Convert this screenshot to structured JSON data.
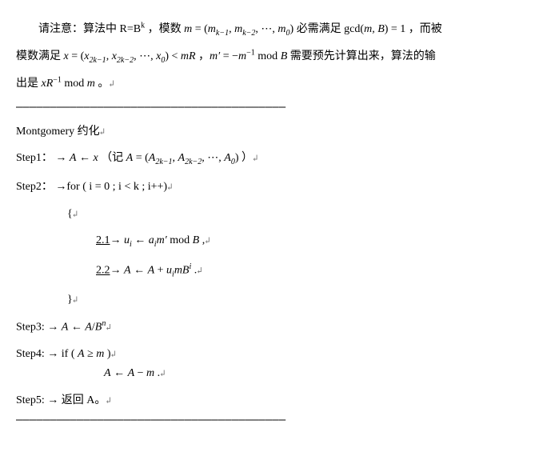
{
  "intro": {
    "line1_pre": "　　请注意：算法中 R=B",
    "line1_sup": "k",
    "line1_mid": " ，模数 ",
    "line1_m": "m",
    "line1_eq": " = (",
    "line1_mk1": "m",
    "line1_mk1_sub": "k−1",
    "line1_c1": ", ",
    "line1_mk2": "m",
    "line1_mk2_sub": "k−2",
    "line1_c2": ", ⋯, ",
    "line1_m0": "m",
    "line1_m0_sub": "0",
    "line1_close": ") ",
    "line1_must": "必需满足 gcd(",
    "line1_mB": "m, B",
    "line1_eq1": ") = 1 ，而被",
    "line2_pre": "模数满足 ",
    "line2_x": "x",
    "line2_eq": " = (",
    "line2_x1": "x",
    "line2_x1_sub": "2k−1",
    "line2_c1": ", ",
    "line2_x2": "x",
    "line2_x2_sub": "2k−2",
    "line2_c2": ", ⋯, ",
    "line2_x0": "x",
    "line2_x0_sub": "0",
    "line2_close": ") < ",
    "line2_mR": "mR",
    "line2_comma": " ，",
    "line2_mp": "m′",
    "line2_eqm": " = −",
    "line2_m": "m",
    "line2_exp": "−1",
    "line2_mod": " mod ",
    "line2_B": "B",
    "line2_rest": " 需要预先计算出来，算法的输",
    "line3_pre": "出是 ",
    "line3_xR": "xR",
    "line3_exp": "−1",
    "line3_mod": " mod ",
    "line3_m": "m",
    "line3_end": " 。"
  },
  "title": "Montgomery 约化",
  "step1": {
    "label": "Step1：",
    "arrow": " → ",
    "A": "A",
    "assign": " ← ",
    "x": "x",
    "note_open": " （记 ",
    "A2": "A",
    "eq": " = (",
    "a1": "A",
    "a1_sub": "2k−1",
    "c1": ", ",
    "a2": "A",
    "a2_sub": "2k−2",
    "c2": ", ⋯, ",
    "a0": "A",
    "a0_sub": "0",
    "close": ") ）"
  },
  "step2": {
    "label": "Step2：",
    "for": " →for ( i = 0 ; i < k ; i++)",
    "open": "{",
    "s21_num": "2.1",
    "s21_arrow": "→ ",
    "s21_u": "u",
    "s21_isub": "i",
    "s21_assign": " ← ",
    "s21_a": "a",
    "s21_isub2": "i",
    "s21_mp": "m′",
    "s21_mod": " mod ",
    "s21_B": "B ",
    "s21_comma": ",",
    "s22_num": "2.2",
    "s22_arrow": "→ ",
    "s22_A": "A",
    "s22_assign": " ← ",
    "s22_A2": "A",
    "s22_plus": " + ",
    "s22_u": "u",
    "s22_isub": "i",
    "s22_m": "mB",
    "s22_exp": "i",
    "s22_end": " .",
    "close": "}"
  },
  "step3": {
    "label": "Step3: → ",
    "A": "A",
    "assign": " ← ",
    "A2": "A",
    "slash": "/",
    "B": "B",
    "exp": "n"
  },
  "step4": {
    "label": "Step4: → if ( ",
    "A": "A",
    "ge": " ≥ ",
    "m": "m",
    "close": " )",
    "A2": "A",
    "assign": " ← ",
    "A3": "A",
    "minus": " − ",
    "m2": "m",
    "end": " ."
  },
  "step5": {
    "label": "Step5: → 返回 A。"
  },
  "divider": "————————————————————————————————————————",
  "ret": "↲"
}
